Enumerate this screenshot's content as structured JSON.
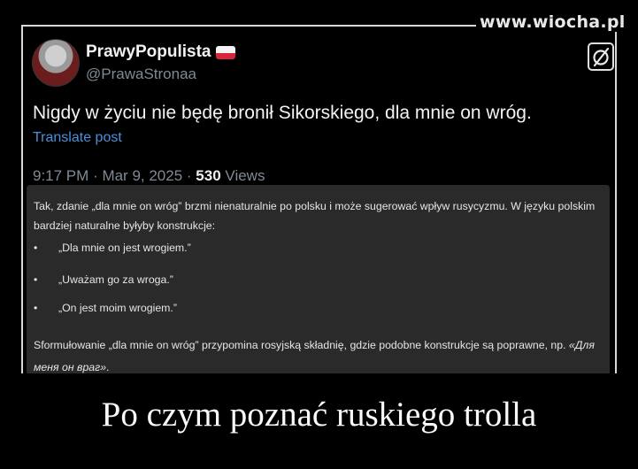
{
  "watermark": "www.wiocha.pl",
  "tweet": {
    "display_name": "PrawyPopulista",
    "handle": "@PrawaStronaa",
    "text": "Nigdy w życiu nie będę bronił Sikorskiego, dla mnie on wróg.",
    "translate_label": "Translate post",
    "time": "9:17 PM",
    "date": "Mar 9, 2025",
    "views_count": "530",
    "views_label": "Views"
  },
  "grok": {
    "paragraph1": "Tak, zdanie „dla mnie on wróg” brzmi nienaturalnie po polsku i może sugerować wpływ rusycyzmu. W języku polskim bardziej naturalne byłyby konstrukcje:",
    "bullets": [
      "„Dla mnie on jest wrogiem.”",
      "„Uważam go za wroga.”",
      "„On jest moim wrogiem.”"
    ],
    "paragraph2_text": "Sformułowanie „dla mnie on wróg” przypomina rosyjską składnię, gdzie podobne konstrukcje są poprawne, np.",
    "paragraph2_example": "«Для меня он враг»",
    "paragraph2_end": "."
  },
  "caption": "Po czym poznać ruskiego trolla",
  "colors": {
    "background": "#000000",
    "link": "#4a90d9",
    "muted": "#7f8a96",
    "card": "#2a2a2a",
    "flag_red": "#d7263d"
  }
}
